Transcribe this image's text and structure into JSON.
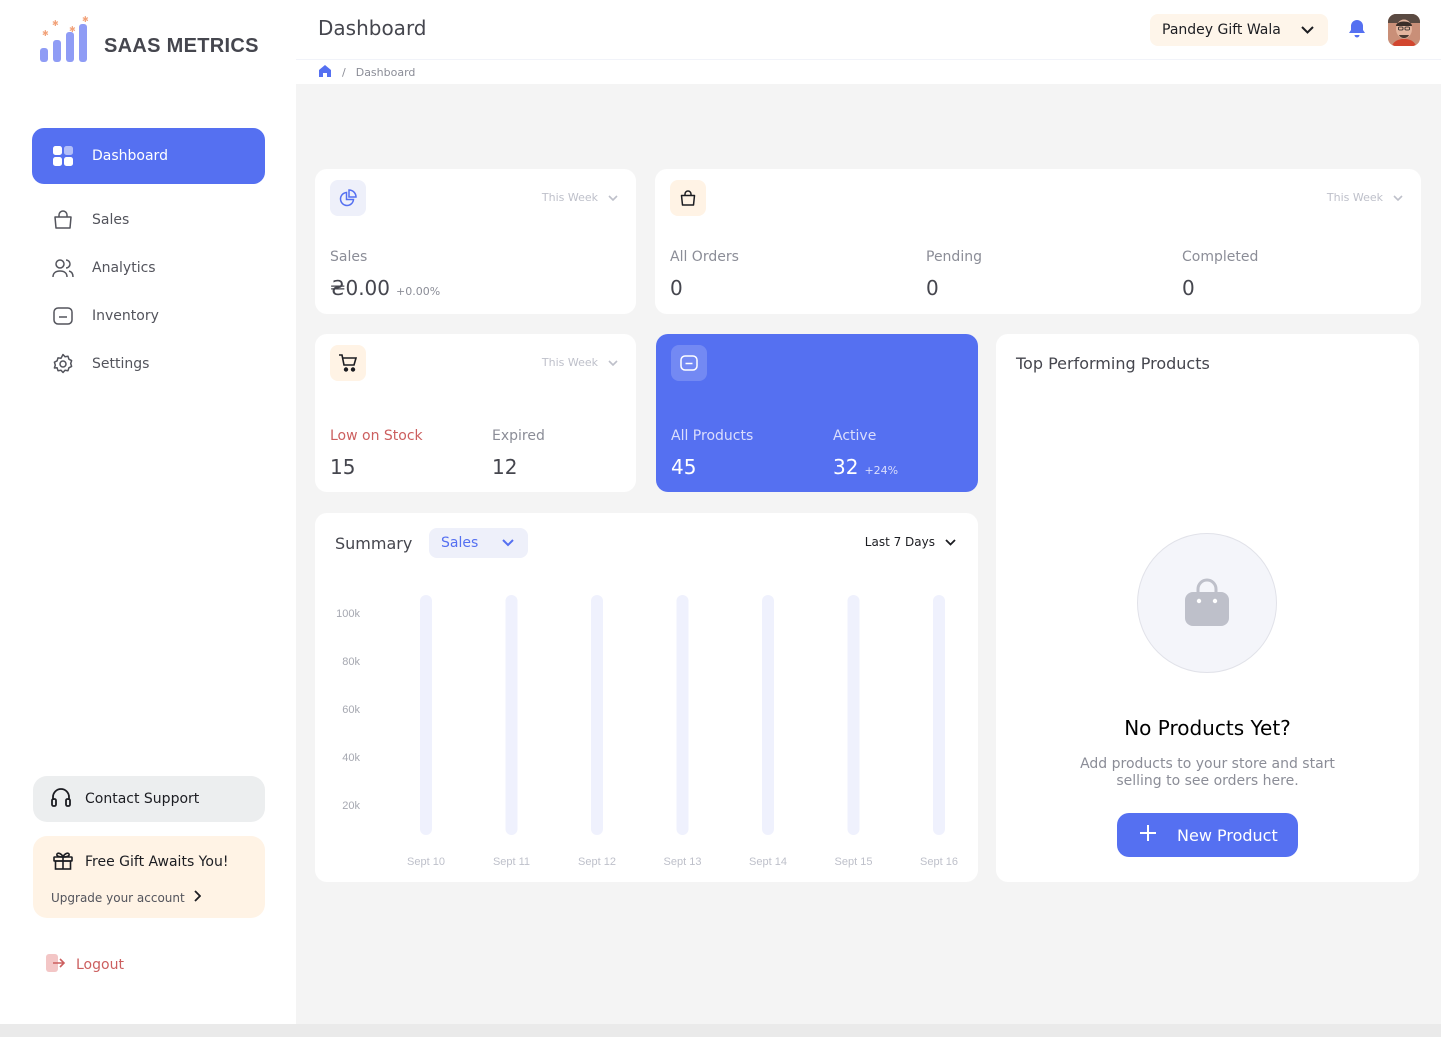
{
  "brand": {
    "name": "SAAS METRICS",
    "accent": "#5570f1"
  },
  "sidebar": {
    "items": [
      {
        "label": "Dashboard",
        "icon": "grid-icon",
        "active": true
      },
      {
        "label": "Sales",
        "icon": "bag-icon"
      },
      {
        "label": "Analytics",
        "icon": "users-icon"
      },
      {
        "label": "Inventory",
        "icon": "folder-icon"
      },
      {
        "label": "Settings",
        "icon": "gear-icon"
      }
    ],
    "support_label": "Contact Support",
    "gift": {
      "title": "Free Gift Awaits You!",
      "subtitle": "Upgrade your account"
    },
    "logout_label": "Logout"
  },
  "header": {
    "title": "Dashboard",
    "store": "Pandey Gift Wala",
    "breadcrumb": {
      "separator": "/",
      "current": "Dashboard"
    }
  },
  "cards": {
    "sales": {
      "period": "This Week",
      "label": "Sales",
      "value": "₴0.00",
      "delta": "+0.00%"
    },
    "orders": {
      "period": "This Week",
      "all_label": "All Orders",
      "all_value": "0",
      "pending_label": "Pending",
      "pending_value": "0",
      "completed_label": "Completed",
      "completed_value": "0"
    },
    "stock": {
      "period": "This Week",
      "low_label": "Low on Stock",
      "low_value": "15",
      "expired_label": "Expired",
      "expired_value": "12"
    },
    "products": {
      "all_label": "All Products",
      "all_value": "45",
      "active_label": "Active",
      "active_value": "32",
      "active_delta": "+24%"
    }
  },
  "summary": {
    "title": "Summary",
    "metric": "Sales",
    "range": "Last 7 Days"
  },
  "chart_data": {
    "type": "bar",
    "categories": [
      "Sept 10",
      "Sept 11",
      "Sept 12",
      "Sept 13",
      "Sept 14",
      "Sept 15",
      "Sept 16"
    ],
    "values": [
      0,
      0,
      0,
      0,
      0,
      0,
      0
    ],
    "yticks": [
      "20k",
      "40k",
      "60k",
      "80k",
      "100k"
    ],
    "ylim": [
      0,
      100000
    ],
    "track_color": "#eff1fd"
  },
  "top_products": {
    "title": "Top Performing Products",
    "empty_title": "No Products Yet?",
    "empty_text": "Add products to your store and start selling to see orders here.",
    "button_label": "New Product"
  }
}
